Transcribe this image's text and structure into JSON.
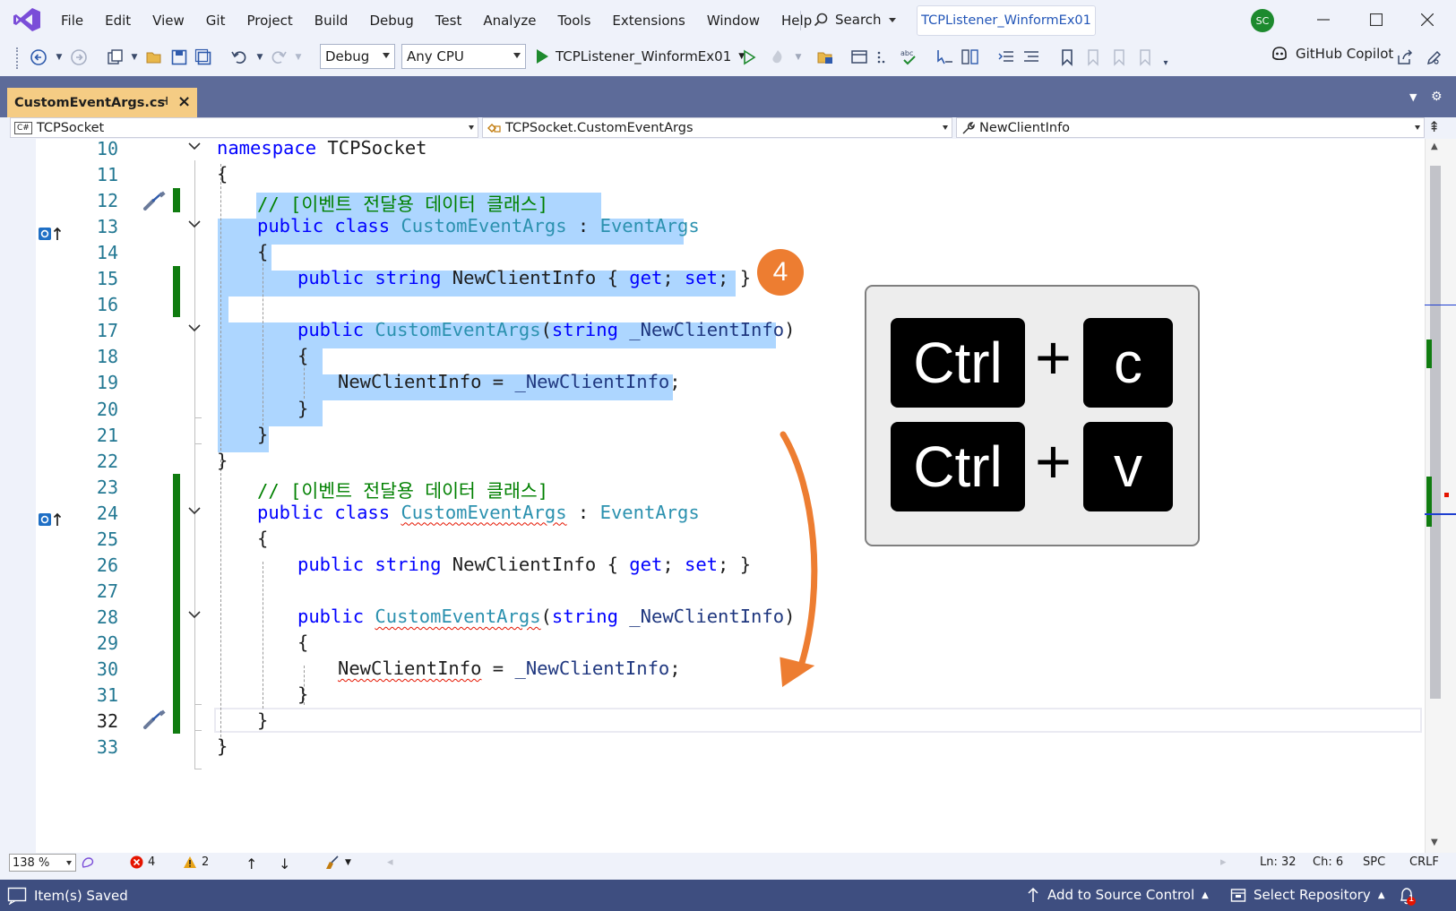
{
  "menu": {
    "items": [
      "File",
      "Edit",
      "View",
      "Git",
      "Project",
      "Build",
      "Debug",
      "Test",
      "Analyze",
      "Tools",
      "Extensions",
      "Window",
      "Help"
    ],
    "search_label": "Search",
    "solution_title": "TCPListener_WinformEx01",
    "avatar_initials": "SC"
  },
  "toolbar": {
    "configuration": "Debug",
    "platform": "Any CPU",
    "startup_project": "TCPListener_WinformEx01",
    "copilot_label": "GitHub Copilot"
  },
  "document_tab": {
    "filename": "CustomEventArgs.cs"
  },
  "navigation": {
    "project": "TCPSocket",
    "type": "TCPSocket.CustomEventArgs",
    "member": "NewClientInfo"
  },
  "editor": {
    "lines": [
      {
        "num": "10",
        "code": [
          [
            "kw",
            "namespace"
          ],
          [
            "",
            "TCPSocket"
          ]
        ]
      },
      {
        "num": "11",
        "code": [
          [
            "",
            "{"
          ]
        ]
      },
      {
        "num": "12",
        "code": [
          [
            "cm",
            "// [이벤트 전달용 데이터 클래스]"
          ]
        ]
      },
      {
        "num": "13",
        "code": [
          [
            "kw",
            "public class "
          ],
          [
            "ty",
            "CustomEventArgs"
          ],
          [
            "",
            " : "
          ],
          [
            "ty",
            "EventArgs"
          ]
        ]
      },
      {
        "num": "14",
        "code": [
          [
            "",
            "{"
          ]
        ]
      },
      {
        "num": "15",
        "code": [
          [
            "kw",
            "public string "
          ],
          [
            "",
            "NewClientInfo { "
          ],
          [
            "kw",
            "get"
          ],
          [
            "",
            "; "
          ],
          [
            "kw",
            "set"
          ],
          [
            "",
            "; }"
          ]
        ]
      },
      {
        "num": "16",
        "code": []
      },
      {
        "num": "17",
        "code": [
          [
            "kw",
            "public "
          ],
          [
            "ty",
            "CustomEventArgs"
          ],
          [
            "",
            "("
          ],
          [
            "kw",
            "string "
          ],
          [
            "pm",
            "_NewClientInfo"
          ],
          [
            "",
            ")"
          ]
        ]
      },
      {
        "num": "18",
        "code": [
          [
            "",
            "{"
          ]
        ]
      },
      {
        "num": "19",
        "code": [
          [
            "",
            "NewClientInfo = "
          ],
          [
            "pm",
            "_NewClientInfo"
          ],
          [
            "",
            ";"
          ]
        ]
      },
      {
        "num": "20",
        "code": [
          [
            "",
            "}"
          ]
        ]
      },
      {
        "num": "21",
        "code": [
          [
            "",
            "}"
          ]
        ]
      },
      {
        "num": "22",
        "code": [
          [
            "",
            "}"
          ]
        ]
      },
      {
        "num": "23",
        "code": [
          [
            "cm",
            "// [이벤트 전달용 데이터 클래스]"
          ]
        ]
      },
      {
        "num": "24",
        "code": [
          [
            "kw",
            "public class "
          ],
          [
            "ty squig",
            "CustomEventArgs"
          ],
          [
            "",
            " : "
          ],
          [
            "ty",
            "EventArgs"
          ]
        ]
      },
      {
        "num": "25",
        "code": [
          [
            "",
            "{"
          ]
        ]
      },
      {
        "num": "26",
        "code": [
          [
            "kw",
            "public string "
          ],
          [
            "",
            "NewClientInfo { "
          ],
          [
            "kw",
            "get"
          ],
          [
            "",
            "; "
          ],
          [
            "kw",
            "set"
          ],
          [
            "",
            "; }"
          ]
        ]
      },
      {
        "num": "27",
        "code": []
      },
      {
        "num": "28",
        "code": [
          [
            "kw",
            "public "
          ],
          [
            "ty squig",
            "CustomEventArgs"
          ],
          [
            "",
            "("
          ],
          [
            "kw",
            "string "
          ],
          [
            "pm",
            "_NewClientInfo"
          ],
          [
            "",
            ")"
          ]
        ]
      },
      {
        "num": "29",
        "code": [
          [
            "",
            "{"
          ]
        ]
      },
      {
        "num": "30",
        "code": [
          [
            "squig",
            "NewClientInfo"
          ],
          [
            "",
            " = "
          ],
          [
            "pm",
            "_NewClientInfo"
          ],
          [
            "",
            ";"
          ]
        ]
      },
      {
        "num": "31",
        "code": [
          [
            "",
            "}"
          ]
        ]
      },
      {
        "num": "32",
        "code": [
          [
            "",
            "}"
          ]
        ]
      },
      {
        "num": "33",
        "code": [
          [
            "",
            "}"
          ]
        ]
      }
    ],
    "current_line": "32"
  },
  "annotation": {
    "step_number": "4",
    "keys": [
      "Ctrl",
      "+",
      "c",
      "Ctrl",
      "+",
      "v"
    ]
  },
  "editor_status": {
    "zoom": "138 %",
    "errors": "4",
    "warnings": "2",
    "line": "Ln: 32",
    "column": "Ch: 6",
    "whitespace": "SPC",
    "line_ending": "CRLF"
  },
  "statusbar": {
    "message": "Item(s) Saved",
    "source_control": "Add to Source Control",
    "repository": "Select Repository",
    "notifications": "1"
  },
  "colors": {
    "accent_orange": "#ED7D31",
    "selection": "#ADD6FF",
    "change_bar": "#107C10",
    "status_bar": "#3E4E80",
    "doc_tab": "#F5CC84"
  }
}
